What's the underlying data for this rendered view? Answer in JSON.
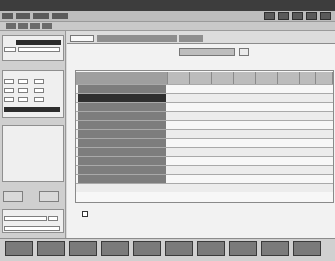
{
  "title": "",
  "menu_items": [],
  "tabs": [],
  "sidebar": {
    "section_1_title": "",
    "section_2_title": "",
    "section_3_title": "",
    "fields": []
  },
  "main": {
    "center_selector_value": "",
    "table": {
      "headers": [],
      "rows": []
    },
    "bottom_checkbox_label": ""
  },
  "footer": {
    "buttons": []
  }
}
